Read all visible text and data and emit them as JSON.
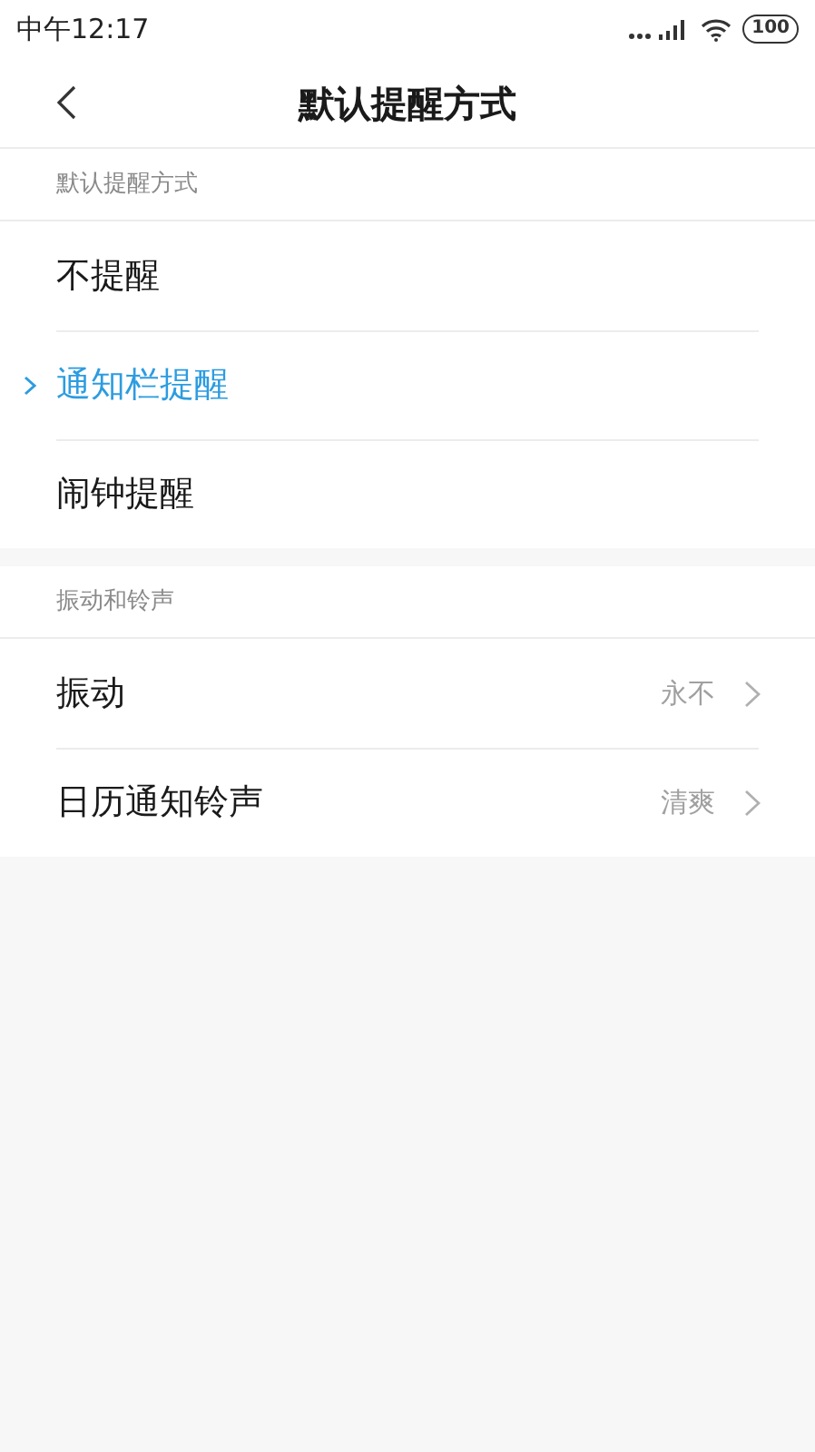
{
  "status_bar": {
    "time": "中午12:17",
    "battery": "100"
  },
  "header": {
    "title": "默认提醒方式"
  },
  "sections": [
    {
      "title": "默认提醒方式",
      "items": [
        {
          "kind": "option",
          "label": "不提醒",
          "selected": false
        },
        {
          "kind": "option",
          "label": "通知栏提醒",
          "selected": true
        },
        {
          "kind": "option",
          "label": "闹钟提醒",
          "selected": false
        }
      ]
    },
    {
      "title": "振动和铃声",
      "items": [
        {
          "kind": "link",
          "label": "振动",
          "value": "永不"
        },
        {
          "kind": "link",
          "label": "日历通知铃声",
          "value": "清爽"
        }
      ]
    }
  ]
}
